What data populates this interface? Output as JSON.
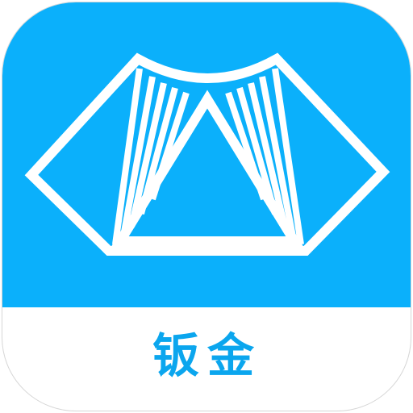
{
  "app": {
    "label": "钣金"
  },
  "icon": {
    "glyph": "sheet-metal-fold-icon"
  },
  "colors": {
    "brand_blue": "#0bb0fb",
    "label_blue": "#0ba6ee",
    "glyph_white": "#ffffff",
    "background": "#ffffff"
  }
}
